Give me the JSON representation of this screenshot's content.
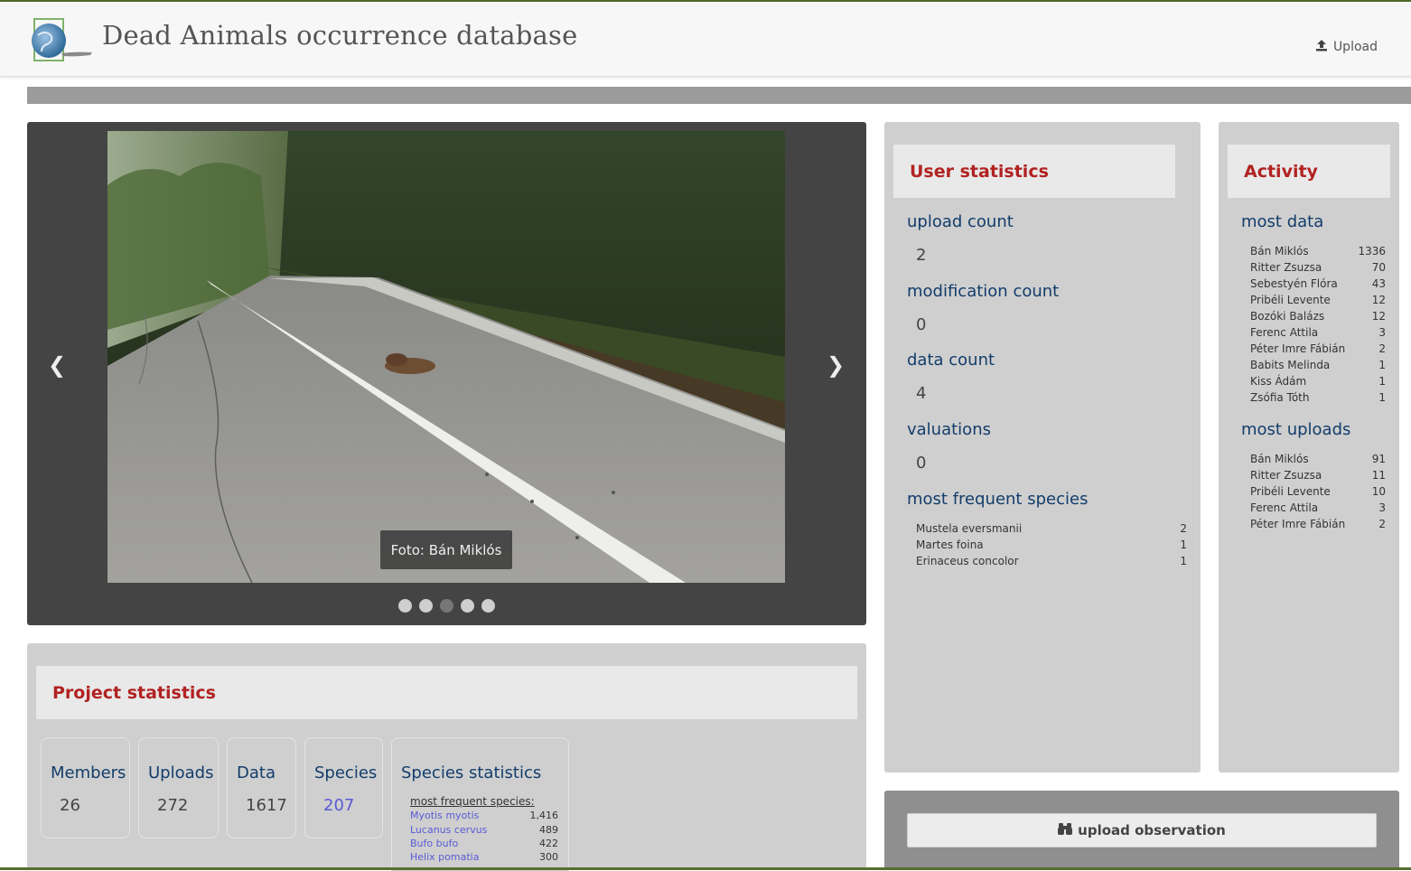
{
  "header": {
    "site_title": "Dead Animals occurrence database",
    "upload_label": "Upload",
    "upload_icon": "upload-icon"
  },
  "carousel": {
    "caption": "Foto: Bán Miklós",
    "prev_glyph": "❮",
    "next_glyph": "❯",
    "slides_total": 5,
    "active_slide_index": 3
  },
  "user_statistics": {
    "title": "User statistics",
    "upload_count_label": "upload count",
    "upload_count": "2",
    "modification_count_label": "modification count",
    "modification_count": "0",
    "data_count_label": "data count",
    "data_count": "4",
    "valuations_label": "valuations",
    "valuations": "0",
    "frequent_species_label": "most frequent species",
    "frequent_species": [
      {
        "name": "Mustela eversmanii",
        "count": "2"
      },
      {
        "name": "Martes foina",
        "count": "1"
      },
      {
        "name": "Erinaceus concolor",
        "count": "1"
      }
    ]
  },
  "activity": {
    "title": "Activity",
    "most_data_label": "most data",
    "most_data": [
      {
        "name": "Bán Miklós",
        "count": "1336"
      },
      {
        "name": "Ritter Zsuzsa",
        "count": "70"
      },
      {
        "name": "Sebestyén Flóra",
        "count": "43"
      },
      {
        "name": "Pribéli Levente",
        "count": "12"
      },
      {
        "name": "Bozóki Balázs",
        "count": "12"
      },
      {
        "name": "Ferenc Attila",
        "count": "3"
      },
      {
        "name": "Péter Imre Fábián",
        "count": "2"
      },
      {
        "name": "Babits Melinda",
        "count": "1"
      },
      {
        "name": "Kiss Ádám",
        "count": "1"
      },
      {
        "name": "Zsófia Tóth",
        "count": "1"
      }
    ],
    "most_uploads_label": "most uploads",
    "most_uploads": [
      {
        "name": "Bán Miklós",
        "count": "91"
      },
      {
        "name": "Ritter Zsuzsa",
        "count": "11"
      },
      {
        "name": "Pribéli Levente",
        "count": "10"
      },
      {
        "name": "Ferenc Attila",
        "count": "3"
      },
      {
        "name": "Péter Imre Fábián",
        "count": "2"
      }
    ]
  },
  "project_statistics": {
    "title": "Project statistics",
    "members_label": "Members",
    "members": "26",
    "uploads_label": "Uploads",
    "uploads": "272",
    "data_label": "Data",
    "data": "1617",
    "species_label": "Species",
    "species": "207",
    "species_stats_label": "Species statistics",
    "most_frequent_label": "most frequent species:",
    "species_list": [
      {
        "name": "Myotis myotis",
        "count": "1,416"
      },
      {
        "name": "Lucanus cervus",
        "count": "489"
      },
      {
        "name": "Bufo bufo",
        "count": "422"
      },
      {
        "name": "Helix pomatia",
        "count": "300"
      }
    ]
  },
  "upload_observation": {
    "label": "upload observation",
    "icon": "binoculars-icon"
  },
  "colors": {
    "accent_red": "#b22222",
    "label_blue": "#123d6b",
    "link_blue": "#5a5ad6",
    "panel_gray": "#cfcfcf"
  }
}
